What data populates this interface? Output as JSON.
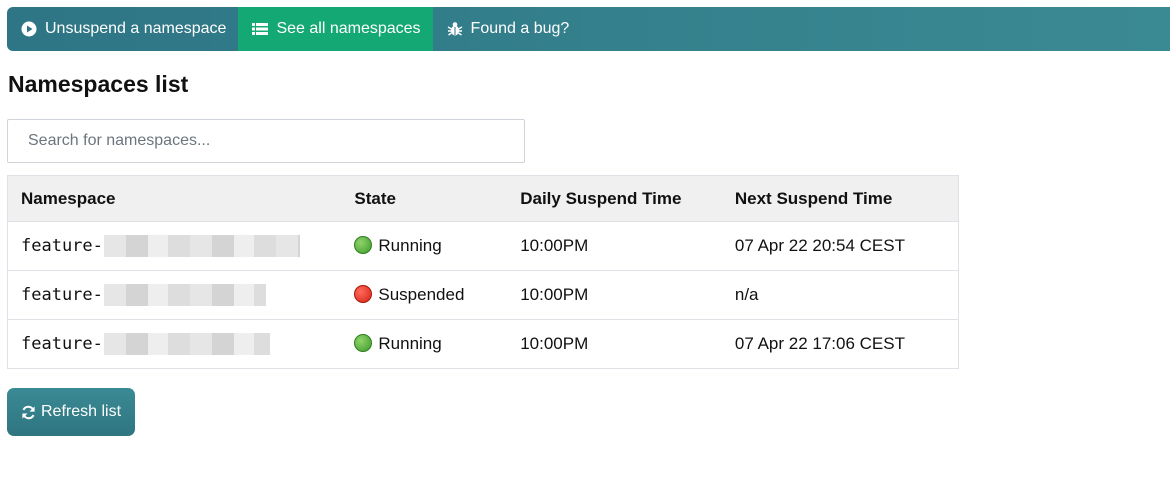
{
  "nav": {
    "items": [
      {
        "label": "Unsuspend a namespace",
        "icon": "play-circle-icon",
        "active": false
      },
      {
        "label": "See all namespaces",
        "icon": "list-icon",
        "active": true
      },
      {
        "label": "Found a bug?",
        "icon": "bug-icon",
        "active": false
      }
    ]
  },
  "page": {
    "title": "Namespaces list"
  },
  "search": {
    "placeholder": "Search for namespaces...",
    "value": ""
  },
  "table": {
    "headers": [
      "Namespace",
      "State",
      "Daily Suspend Time",
      "Next Suspend Time"
    ],
    "rows": [
      {
        "namespace_prefix": "feature-",
        "state": "Running",
        "state_color": "green",
        "daily": "10:00PM",
        "next": "07 Apr 22 20:54 CEST"
      },
      {
        "namespace_prefix": "feature-",
        "state": "Suspended",
        "state_color": "red",
        "daily": "10:00PM",
        "next": "n/a"
      },
      {
        "namespace_prefix": "feature-",
        "state": "Running",
        "state_color": "green",
        "daily": "10:00PM",
        "next": "07 Apr 22 17:06 CEST"
      }
    ]
  },
  "refresh": {
    "label": "Refresh list",
    "icon": "refresh-icon"
  },
  "colors": {
    "nav_bg": "#2e7585",
    "nav_active": "#14a874",
    "running": "#3e9b2a",
    "suspended": "#d42316"
  }
}
